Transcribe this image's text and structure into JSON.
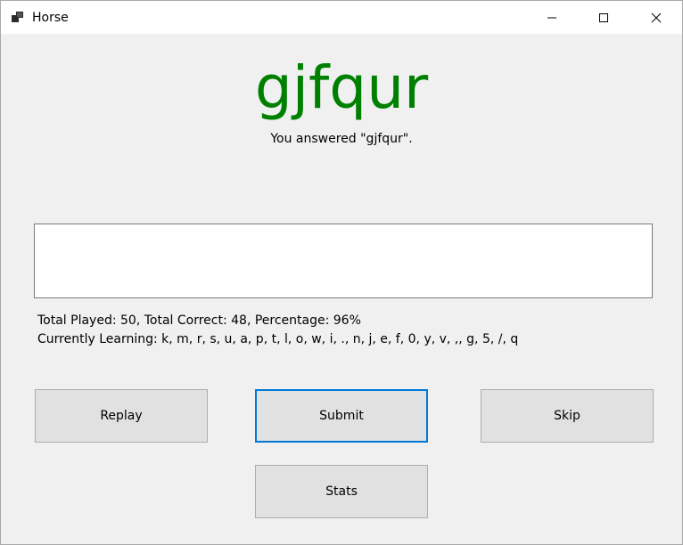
{
  "window": {
    "title": "Horse",
    "icon": "app-window-icon"
  },
  "quiz": {
    "word": "gjfqur",
    "word_color": "#008000",
    "answer_feedback": "You answered \"gjfqur\".",
    "answer_value": "",
    "answer_placeholder": ""
  },
  "stats": {
    "summary": "Total Played: 50, Total Correct: 48, Percentage: 96%",
    "learning": "Currently Learning: k, m, r, s, u, a, p, t, l, o, w, i, ., n, j, e, f, 0, y, v, ,, g, 5, /, q"
  },
  "buttons": {
    "replay": "Replay",
    "submit": "Submit",
    "skip": "Skip",
    "stats": "Stats"
  },
  "colors": {
    "focus_accent": "#0078d7",
    "button_face": "#e1e1e1",
    "window_bg": "#f0f0f0"
  }
}
